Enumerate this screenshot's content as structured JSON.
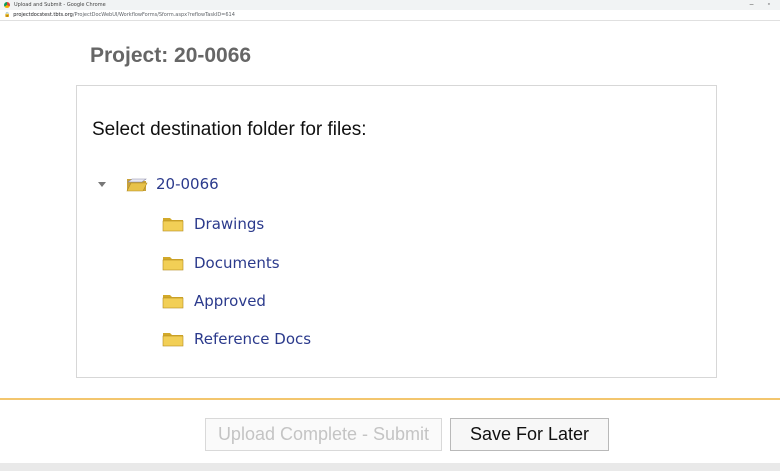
{
  "browser": {
    "window_title": "Upload and Submit - Google Chrome",
    "url_host": "projectdocstest.tbts.org",
    "url_path": "/ProjectDocWebUI/WorkflowForms/Sform.aspx?reflowTaskID=614"
  },
  "page": {
    "title": "Project: 20-0066",
    "prompt": "Select destination folder for files:"
  },
  "tree": {
    "root": {
      "label": "20-0066",
      "expanded": true,
      "icon": "open-folder-icon"
    },
    "items": [
      {
        "label": "Drawings",
        "icon": "folder-icon"
      },
      {
        "label": "Documents",
        "icon": "folder-icon"
      },
      {
        "label": "Approved",
        "icon": "folder-icon"
      },
      {
        "label": "Reference Docs",
        "icon": "folder-icon"
      }
    ]
  },
  "actions": {
    "submit_label": "Upload Complete - Submit",
    "submit_enabled": false,
    "save_label": "Save For Later"
  },
  "colors": {
    "link": "#2b3a8c",
    "separator": "#f3c66e",
    "title": "#666666"
  }
}
